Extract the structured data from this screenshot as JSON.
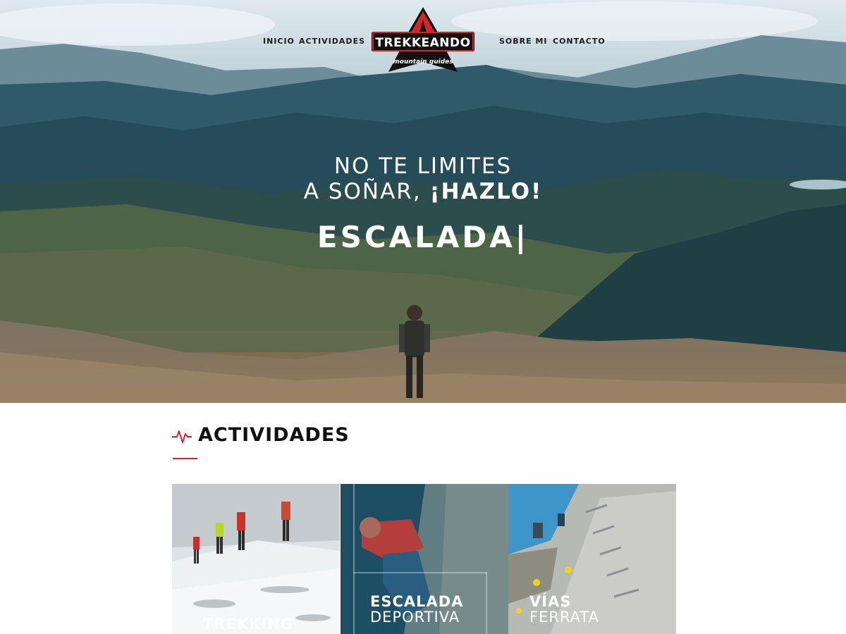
{
  "nav": {
    "items": [
      {
        "label": "INICIO"
      },
      {
        "label": "ACTIVIDADES"
      },
      {
        "label": "SOBRE MI"
      },
      {
        "label": "CONTACTO"
      }
    ]
  },
  "logo": {
    "name": "TREKKEANDO",
    "tagline": "mountain guides",
    "icon": "mountain-peak-icon"
  },
  "hero": {
    "line1": "NO TE LIMITES",
    "line2_prefix": "A SOÑAR, ",
    "line2_emphasis": "¡HAZLO!",
    "typed_word": "ESCALADA|"
  },
  "activities": {
    "icon": "pulse-icon",
    "title": "ACTIVIDADES",
    "cards": [
      {
        "bold": "TREKKING",
        "light": ""
      },
      {
        "bold": "ESCALADA",
        "light": "DEPORTIVA"
      },
      {
        "bold": "VÍAS",
        "light": "FERRATA"
      }
    ]
  },
  "colors": {
    "accent": "#d4252b",
    "text_dark": "#111111",
    "hero_text": "#ffffff"
  }
}
